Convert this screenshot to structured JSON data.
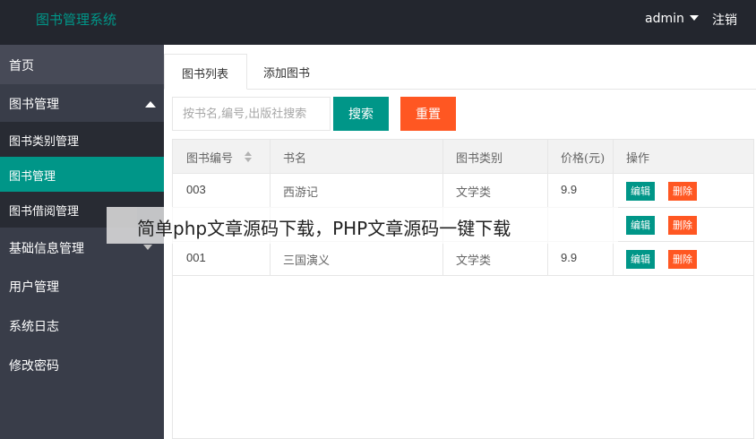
{
  "header": {
    "title": "图书管理系统",
    "user": "admin",
    "logout": "注销"
  },
  "sidebar": {
    "home": "首页",
    "books": "图书管理",
    "sub": [
      "图书类别管理",
      "图书管理",
      "图书借阅管理"
    ],
    "basic": "基础信息管理",
    "users": "用户管理",
    "log": "系统日志",
    "password": "修改密码"
  },
  "tabs": [
    "图书列表",
    "添加图书"
  ],
  "search": {
    "placeholder": "按书名,编号,出版社搜索",
    "search_label": "搜索",
    "reset_label": "重置"
  },
  "table": {
    "headers": [
      "图书编号",
      "书名",
      "图书类别",
      "价格(元)",
      "操作"
    ],
    "rows": [
      {
        "id": "003",
        "name": "西游记",
        "category": "文学类",
        "price": "9.9"
      },
      {
        "id": "",
        "name": "",
        "category": "",
        "price": ""
      },
      {
        "id": "001",
        "name": "三国演义",
        "category": "文学类",
        "price": "9.9"
      }
    ],
    "edit_label": "编辑",
    "delete_label": "删除"
  },
  "watermark": "简单php文章源码下载，PHP文章源码一键下载",
  "colors": {
    "header_bg": "#23262e",
    "sidebar_bg": "#393d49",
    "accent": "#009688",
    "danger": "#ff5722"
  }
}
